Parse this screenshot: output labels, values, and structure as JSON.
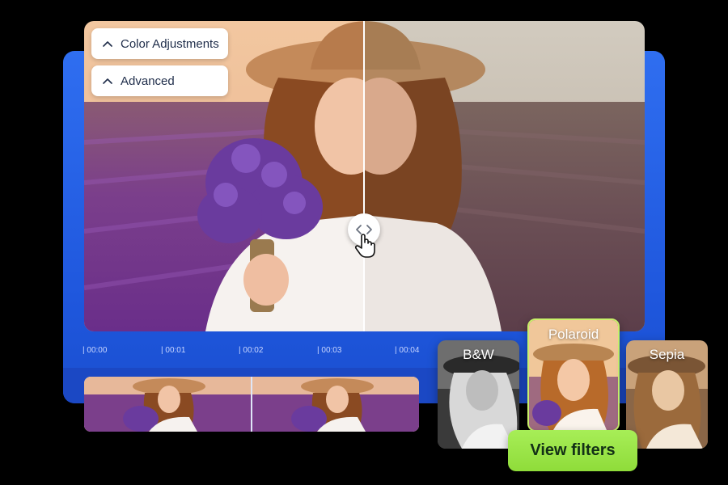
{
  "panels": {
    "color_adjustments": "Color Adjustments",
    "advanced": "Advanced"
  },
  "timeline": {
    "ticks": [
      "| 00:00",
      "| 00:01",
      "| 00:02",
      "| 00:03",
      "| 00:04"
    ]
  },
  "filters": {
    "bw": "B&W",
    "polaroid": "Polaroid",
    "sepia": "Sepia",
    "selected": "Polaroid"
  },
  "view_filters_button": "View filters",
  "colors": {
    "panel_blue": "#2f6ef0",
    "accent_green": "#a7ee57",
    "selected_border": "#c8f06a"
  },
  "icons": {
    "expand": "chevron-up-icon",
    "compare": "chevrons-left-right-icon",
    "cursor": "hand-pointer-icon"
  }
}
